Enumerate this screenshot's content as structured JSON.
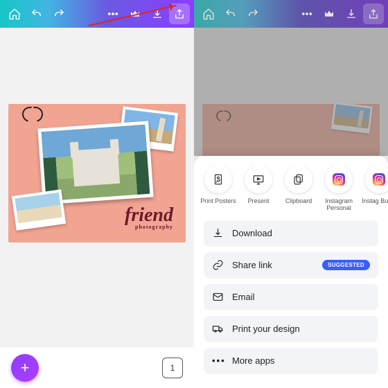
{
  "left": {
    "design": {
      "title": "friend",
      "subtitle": "photography"
    },
    "pages_count": "1"
  },
  "right": {
    "share_targets": [
      {
        "id": "print-posters",
        "label": "Print Posters"
      },
      {
        "id": "present",
        "label": "Present"
      },
      {
        "id": "clipboard",
        "label": "Clipboard"
      },
      {
        "id": "instagram-personal",
        "label": "Instagram Personal"
      },
      {
        "id": "instagram-business",
        "label": "Instag Busin"
      }
    ],
    "options": {
      "download": "Download",
      "share_link": "Share link",
      "share_badge": "SUGGESTED",
      "email": "Email",
      "print": "Print your design",
      "more": "More apps"
    }
  }
}
